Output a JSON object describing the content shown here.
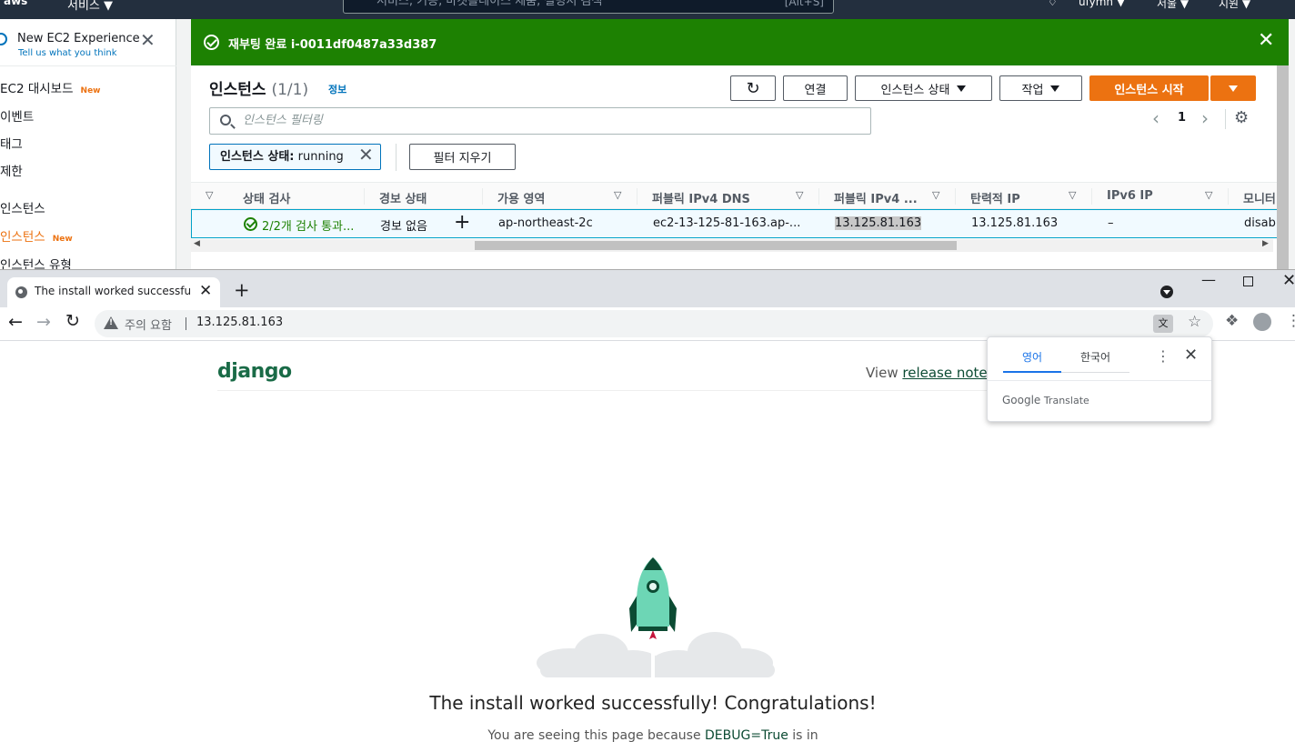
{
  "aws": {
    "topnav": {
      "logo": "aws",
      "services": "서비스 ▼",
      "search_placeholder": "서비스, 기능, 마켓플레이스 제품, 설명서 검색",
      "search_shortcut": "[Alt+S]",
      "account": "ufymn ▼",
      "region": "서울 ▼",
      "support": "지원 ▼"
    },
    "sidebar": {
      "experience_title": "New EC2 Experience",
      "experience_sub": "Tell us what you think",
      "items": [
        {
          "label": "EC2 대시보드",
          "badge": "New"
        },
        {
          "label": "이벤트"
        },
        {
          "label": "태그"
        },
        {
          "label": "제한"
        },
        {
          "label": "인스턴스"
        },
        {
          "label": "인스턴스",
          "badge": "New"
        },
        {
          "label": "인스턴스 유형"
        }
      ]
    },
    "flash": {
      "message": "재부팅 완료 i-0011df0487a33d387"
    },
    "panel": {
      "title": "인스턴스",
      "count": "(1/1)",
      "info": "정보",
      "buttons": {
        "connect": "연결",
        "instance_state": "인스턴스 상태",
        "actions": "작업",
        "launch": "인스턴스 시작"
      },
      "filter_placeholder": "인스턴스 필터링",
      "page": "1",
      "token_key": "인스턴스 상태:",
      "token_value": "running",
      "clear_filters": "필터 지우기",
      "columns": [
        "상태 검사",
        "경보 상태",
        "가용 영역",
        "퍼블릭 IPv4 DNS",
        "퍼블릭 IPv4 ...",
        "탄력적 IP",
        "IPv6 IP",
        "모니터"
      ],
      "row": {
        "status_check": "2/2개 검사 통과...",
        "alarm": "경보 없음",
        "az": "ap-northeast-2c",
        "dns": "ec2-13-125-81-163.ap-...",
        "ipv4": "13.125.81.163",
        "eip": "13.125.81.163",
        "ipv6": "–",
        "monitoring": "disab"
      }
    }
  },
  "chrome": {
    "tab_title": "The install worked successfully! Congratulations!",
    "omnibox": {
      "warning": "주의 요함",
      "url": "13.125.81.163"
    },
    "translate": {
      "tab_source": "영어",
      "tab_target": "한국어",
      "brand_google": "Google",
      "brand_translate": "Translate"
    }
  },
  "django": {
    "logo": "django",
    "view_prefix": "View ",
    "release_notes": "release notes",
    "headline": "The install worked successfully! Congratulations!",
    "sub_prefix": "You are seeing this page because ",
    "sub_debug": "DEBUG=True",
    "sub_suffix": " is in"
  },
  "colors": {
    "aws_nav": "#232f3e",
    "success": "#1d8102",
    "primary_orange": "#ec7211",
    "django_green": "#0c4b33",
    "rocket_body": "#6dd6b5"
  }
}
